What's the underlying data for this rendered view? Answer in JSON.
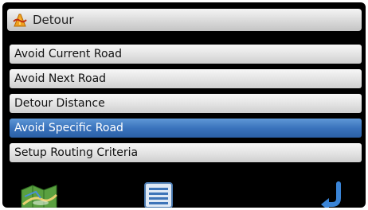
{
  "window": {
    "title": "Detour",
    "title_icon": "detour-icon"
  },
  "menu": {
    "items": [
      {
        "label": "Avoid Current Road",
        "selected": false
      },
      {
        "label": "Avoid Next Road",
        "selected": false
      },
      {
        "label": "Detour Distance",
        "selected": false
      },
      {
        "label": "Avoid Specific Road",
        "selected": true
      },
      {
        "label": "Setup Routing Criteria",
        "selected": false
      }
    ]
  },
  "toolbar": {
    "map_icon": "map-icon",
    "list_icon": "list-icon",
    "back_icon": "back-arrow-icon"
  },
  "colors": {
    "background": "#000000",
    "selected": "#3a73bd",
    "item": "#e2e2e2"
  }
}
